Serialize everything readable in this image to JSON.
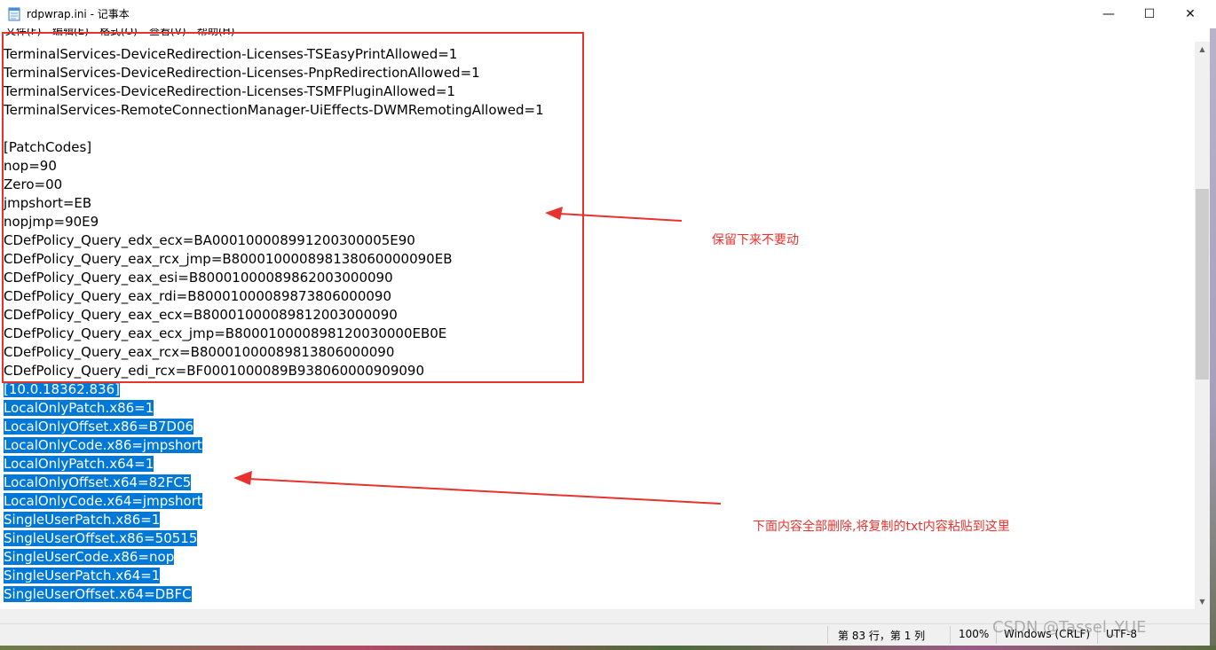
{
  "window": {
    "title": "rdpwrap.ini - 记事本",
    "controls": {
      "minimize": "—",
      "maximize": "☐",
      "close": "✕"
    }
  },
  "menu": [
    "文件(F)",
    "编辑(E)",
    "格式(O)",
    "查看(V)",
    "帮助(H)"
  ],
  "editor": {
    "lines": [
      {
        "text": "TerminalServices-DeviceRedirection-Licenses-TSEasyPrintAllowed=1",
        "selected": false
      },
      {
        "text": "TerminalServices-DeviceRedirection-Licenses-PnpRedirectionAllowed=1",
        "selected": false
      },
      {
        "text": "TerminalServices-DeviceRedirection-Licenses-TSMFPluginAllowed=1",
        "selected": false
      },
      {
        "text": "TerminalServices-RemoteConnectionManager-UiEffects-DWMRemotingAllowed=1",
        "selected": false
      },
      {
        "text": "",
        "selected": false
      },
      {
        "text": "[PatchCodes]",
        "selected": false
      },
      {
        "text": "nop=90",
        "selected": false
      },
      {
        "text": "Zero=00",
        "selected": false
      },
      {
        "text": "jmpshort=EB",
        "selected": false
      },
      {
        "text": "nopjmp=90E9",
        "selected": false
      },
      {
        "text": "CDefPolicy_Query_edx_ecx=BA000100008991200300005E90",
        "selected": false
      },
      {
        "text": "CDefPolicy_Query_eax_rcx_jmp=B800010000898138060000090EB",
        "selected": false
      },
      {
        "text": "CDefPolicy_Query_eax_esi=B80001000089862003000090",
        "selected": false
      },
      {
        "text": "CDefPolicy_Query_eax_rdi=B80001000089873806000090",
        "selected": false
      },
      {
        "text": "CDefPolicy_Query_eax_ecx=B80001000089812003000090",
        "selected": false
      },
      {
        "text": "CDefPolicy_Query_eax_ecx_jmp=B800010000898120030000EB0E",
        "selected": false
      },
      {
        "text": "CDefPolicy_Query_eax_rcx=B80001000089813806000090",
        "selected": false
      },
      {
        "text": "CDefPolicy_Query_edi_rcx=BF0001000089B938060000909090",
        "selected": false
      },
      {
        "text": "[10.0.18362.836]",
        "selected": true
      },
      {
        "text": "LocalOnlyPatch.x86=1",
        "selected": true
      },
      {
        "text": "LocalOnlyOffset.x86=B7D06",
        "selected": true
      },
      {
        "text": "LocalOnlyCode.x86=jmpshort",
        "selected": true
      },
      {
        "text": "LocalOnlyPatch.x64=1",
        "selected": true
      },
      {
        "text": "LocalOnlyOffset.x64=82FC5",
        "selected": true
      },
      {
        "text": "LocalOnlyCode.x64=jmpshort",
        "selected": true
      },
      {
        "text": "SingleUserPatch.x86=1",
        "selected": true
      },
      {
        "text": "SingleUserOffset.x86=50515",
        "selected": true
      },
      {
        "text": "SingleUserCode.x86=nop",
        "selected": true
      },
      {
        "text": "SingleUserPatch.x64=1",
        "selected": true
      },
      {
        "text": "SingleUserOffset.x64=DBFC",
        "selected": true
      }
    ],
    "selection_color": "#0078d7"
  },
  "status": {
    "position": "第 83 行，第 1 列",
    "zoom": "100%",
    "line_ending": "Windows (CRLF)",
    "encoding": "UTF-8"
  },
  "annotations": {
    "keep_note": "保留下来不要动",
    "delete_note": "下面内容全部删除,将复制的txt内容粘贴到这里",
    "color": "#e8322e"
  },
  "watermark": "CSDN @Tassel_YUE"
}
